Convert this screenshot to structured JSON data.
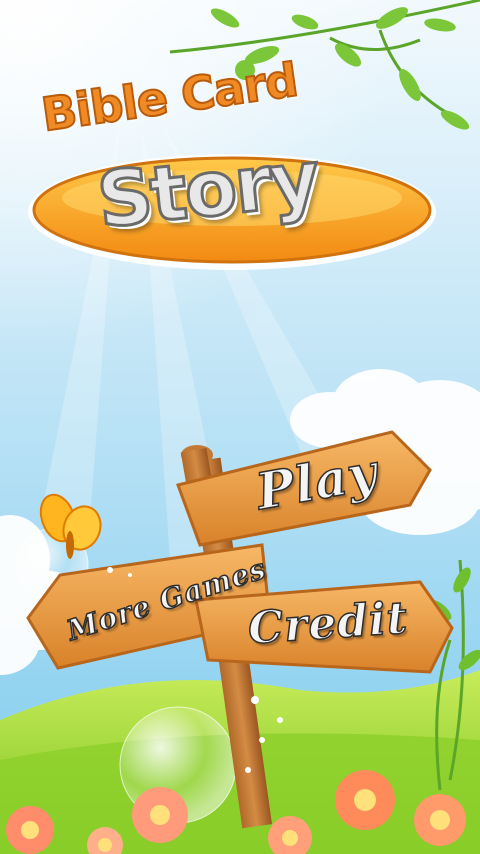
{
  "game": {
    "title_line1": "Bible Card",
    "title_line2": "Story"
  },
  "menu": {
    "play_label": "Play",
    "more_games_label": "More Games",
    "credit_label": "Credit"
  },
  "colors": {
    "sky_top": "#d6ecf7",
    "sky_bottom": "#8cd0ef",
    "grass": "#9fd83a",
    "sign_wood": "#e89a3c",
    "title_orange": "#f08a24",
    "title_plate": "#f7a51e"
  }
}
